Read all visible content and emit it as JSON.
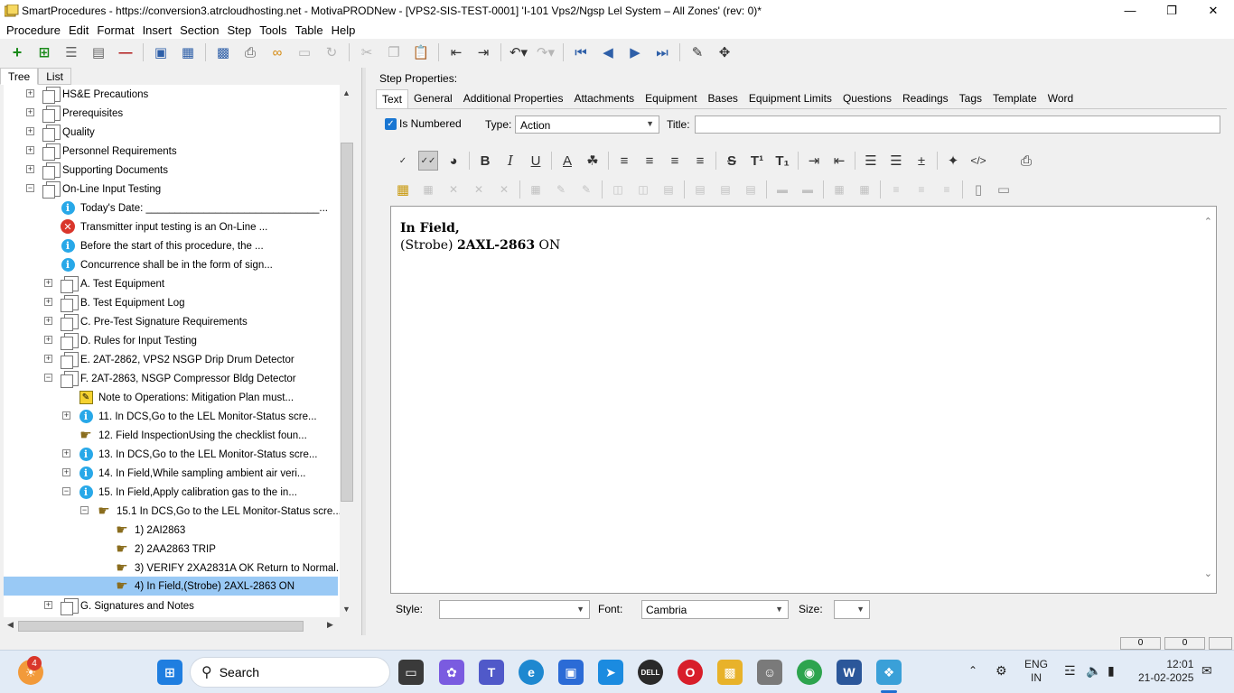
{
  "window": {
    "title": "SmartProcedures - https://conversion3.atrcloudhosting.net - MotivaPRODNew - [VPS2-SIS-TEST-0001] 'I-101 Vps2/Ngsp Lel System – All Zones' (rev: 0)*"
  },
  "menu": [
    {
      "label": "Procedure"
    },
    {
      "label": "Edit"
    },
    {
      "label": "Format"
    },
    {
      "label": "Insert"
    },
    {
      "label": "Section"
    },
    {
      "label": "Step"
    },
    {
      "label": "Tools"
    },
    {
      "label": "Table"
    },
    {
      "label": "Help"
    }
  ],
  "left_tabs": [
    {
      "label": "Tree"
    },
    {
      "label": "List"
    }
  ],
  "tree": [
    {
      "label": "HS&E Precautions",
      "icon": "doc"
    },
    {
      "label": "Prerequisites",
      "icon": "doc"
    },
    {
      "label": "Quality",
      "icon": "doc"
    },
    {
      "label": "Personnel Requirements",
      "icon": "doc"
    },
    {
      "label": "Supporting Documents",
      "icon": "doc"
    },
    {
      "label": "On-Line Input Testing",
      "icon": "doc"
    },
    {
      "label": "Today's Date: ______________________________...",
      "icon": "info"
    },
    {
      "label": "Transmitter input testing is an On-Line ...",
      "icon": "error"
    },
    {
      "label": "Before the start of this procedure, the ...",
      "icon": "info"
    },
    {
      "label": "Concurrence shall be in the form of sign...",
      "icon": "info"
    },
    {
      "label": "A. Test Equipment",
      "icon": "doc"
    },
    {
      "label": "B. Test Equipment Log",
      "icon": "doc"
    },
    {
      "label": "C. Pre-Test Signature Requirements",
      "icon": "doc"
    },
    {
      "label": "D. Rules for Input Testing",
      "icon": "doc"
    },
    {
      "label": "E. 2AT-2862, VPS2 NSGP Drip Drum Detector",
      "icon": "doc"
    },
    {
      "label": "F. 2AT-2863, NSGP Compressor Bldg Detector",
      "icon": "doc"
    },
    {
      "label": "Note to Operations: Mitigation Plan must...",
      "icon": "note"
    },
    {
      "label": "11. In DCS,Go to the LEL Monitor-Status scre...",
      "icon": "info"
    },
    {
      "label": "12. Field InspectionUsing the checklist foun...",
      "icon": "hand"
    },
    {
      "label": "13. In DCS,Go to the LEL Monitor-Status scre...",
      "icon": "info"
    },
    {
      "label": "14. In Field,While sampling ambient air veri...",
      "icon": "info"
    },
    {
      "label": "15. In Field,Apply calibration gas to the in...",
      "icon": "info"
    },
    {
      "label": "15.1 In DCS,Go to the LEL Monitor-Status scre...",
      "icon": "hand"
    },
    {
      "label": "1) 2AI2863",
      "icon": "hand"
    },
    {
      "label": "2) 2AA2863 TRIP",
      "icon": "hand"
    },
    {
      "label": "3) VERIFY 2XA2831A OK Return to Normal...",
      "icon": "hand"
    },
    {
      "label": "4) In Field,(Strobe) 2AXL-2863 ON",
      "icon": "hand"
    },
    {
      "label": "G. Signatures and Notes",
      "icon": "doc"
    }
  ],
  "step_properties": {
    "heading": "Step Properties:",
    "tabs": [
      {
        "label": "Text"
      },
      {
        "label": "General"
      },
      {
        "label": "Additional Properties"
      },
      {
        "label": "Attachments"
      },
      {
        "label": "Equipment"
      },
      {
        "label": "Bases"
      },
      {
        "label": "Equipment Limits"
      },
      {
        "label": "Questions"
      },
      {
        "label": "Readings"
      },
      {
        "label": "Tags"
      },
      {
        "label": "Template"
      },
      {
        "label": "Word"
      }
    ],
    "is_numbered_label": "Is Numbered",
    "type_label": "Type:",
    "type_value": "Action",
    "title_label": "Title:",
    "title_value": ""
  },
  "editor": {
    "line1_bold": "In Field,",
    "line2_prefix": "(Strobe) ",
    "line2_bold": "2AXL-2863",
    "line2_suffix": " ON"
  },
  "bottom": {
    "style_label": "Style:",
    "style_value": "",
    "font_label": "Font:",
    "font_value": "Cambria",
    "size_label": "Size:",
    "size_value": ""
  },
  "statusbar": {
    "cell1": "0",
    "cell2": "0"
  },
  "taskbar": {
    "badge_count": "4",
    "search_label": "Search",
    "lang_line1": "ENG",
    "lang_line2": "IN",
    "time": "12:01",
    "date": "21-02-2025"
  }
}
